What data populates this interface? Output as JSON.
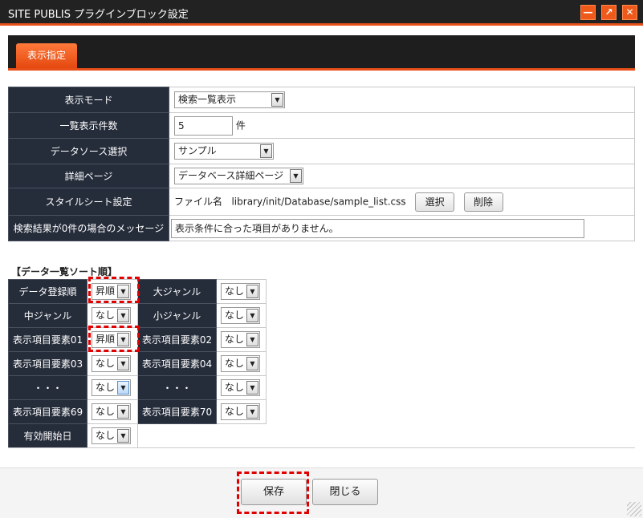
{
  "window": {
    "title": "SITE PUBLIS プラグインブロック設定",
    "min_icon": "minimize-icon",
    "max_icon": "maximize-icon",
    "close_icon": "close-icon"
  },
  "tabs": [
    {
      "label": "表示指定",
      "active": true
    }
  ],
  "settings": {
    "display_mode": {
      "label": "表示モード",
      "value": "検索一覧表示"
    },
    "list_count": {
      "label": "一覧表示件数",
      "value": "5",
      "unit": "件"
    },
    "datasource": {
      "label": "データソース選択",
      "value": "サンプル"
    },
    "detail_page": {
      "label": "詳細ページ",
      "value": "データベース詳細ページ"
    },
    "stylesheet": {
      "label": "スタイルシート設定",
      "prefix": "ファイル名",
      "path": "library/init/Database/sample_list.css",
      "select_button": "選択",
      "delete_button": "削除"
    },
    "no_result": {
      "label": "検索結果が0件の場合のメッセージ",
      "value": "表示条件に合った項目がありません。"
    }
  },
  "sort": {
    "heading": "【データ一覧ソート順】",
    "rows": [
      [
        {
          "label": "データ登録順",
          "value": "昇順"
        },
        {
          "label": "大ジャンル",
          "value": "なし"
        }
      ],
      [
        {
          "label": "中ジャンル",
          "value": "なし"
        },
        {
          "label": "小ジャンル",
          "value": "なし"
        }
      ],
      [
        {
          "label": "表示項目要素01",
          "value": "昇順"
        },
        {
          "label": "表示項目要素02",
          "value": "なし"
        }
      ],
      [
        {
          "label": "表示項目要素03",
          "value": "なし"
        },
        {
          "label": "表示項目要素04",
          "value": "なし"
        }
      ],
      [
        {
          "label": "・・・",
          "value": "なし"
        },
        {
          "label": "・・・",
          "value": "なし"
        }
      ],
      [
        {
          "label": "表示項目要素69",
          "value": "なし"
        },
        {
          "label": "表示項目要素70",
          "value": "なし"
        }
      ],
      [
        {
          "label": "有効開始日",
          "value": "なし"
        }
      ]
    ]
  },
  "footer": {
    "save_label": "保存",
    "close_label": "閉じる"
  },
  "colors": {
    "accent": "#e8501a",
    "label_bg": "#252c3a",
    "highlight": "#e00000"
  }
}
